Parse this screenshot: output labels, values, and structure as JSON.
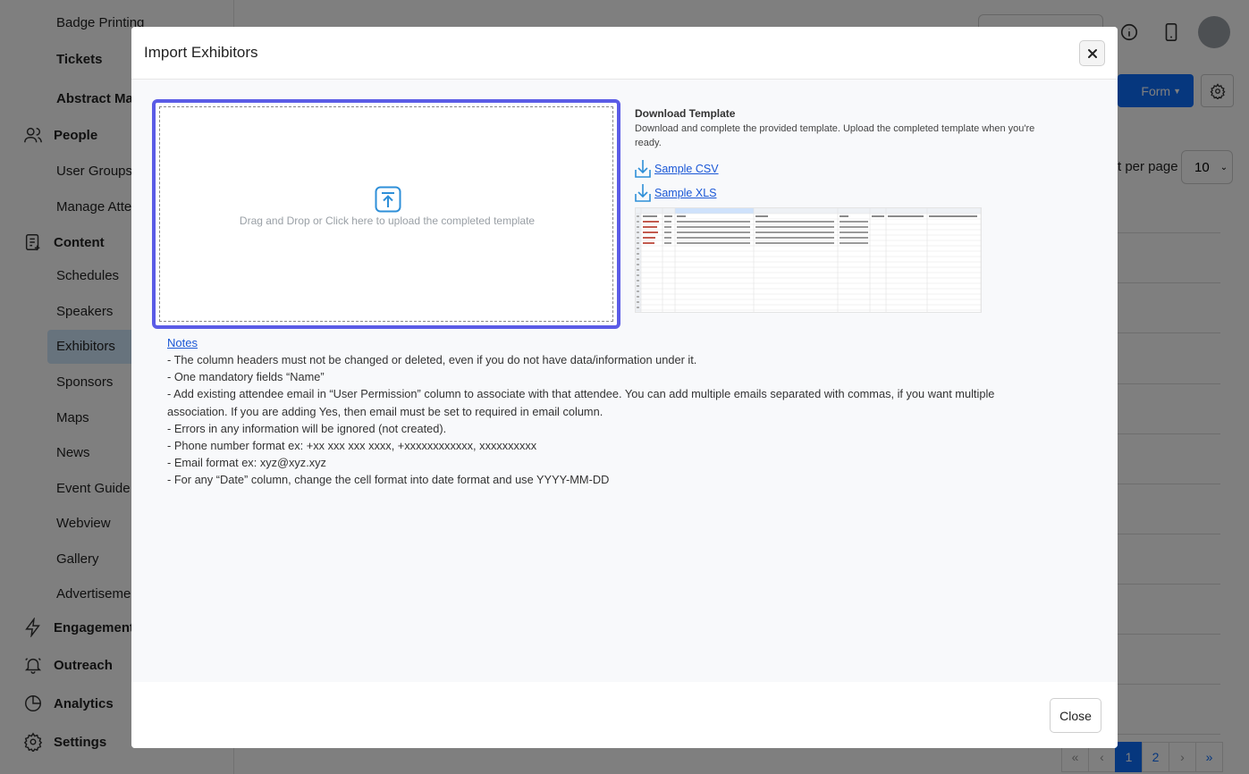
{
  "sidebar": {
    "items": [
      {
        "label": "Badge Printing"
      },
      {
        "label": "Tickets"
      },
      {
        "label": "Abstract Ma"
      },
      {
        "label": "User Groups"
      },
      {
        "label": "Manage Atte"
      },
      {
        "label": "Schedules"
      },
      {
        "label": "Speakers"
      },
      {
        "label": "Exhibitors"
      },
      {
        "label": "Sponsors"
      },
      {
        "label": "Maps"
      },
      {
        "label": "News"
      },
      {
        "label": "Event Guide"
      },
      {
        "label": "Webview"
      },
      {
        "label": "Gallery"
      },
      {
        "label": "Advertiseme"
      }
    ],
    "sections": [
      {
        "label": "People",
        "icon": "people-icon"
      },
      {
        "label": "Content",
        "icon": "content-icon"
      },
      {
        "label": "Engagement",
        "icon": "lightning-icon"
      },
      {
        "label": "Outreach",
        "icon": "bell-icon"
      },
      {
        "label": "Analytics",
        "icon": "pie-chart-icon"
      },
      {
        "label": "Settings",
        "icon": "gear-icon"
      }
    ]
  },
  "background": {
    "form_button": "Form",
    "per_page_label": "t per page",
    "per_page_value": "10",
    "pagination": [
      "«",
      "‹",
      "1",
      "2",
      "›",
      "»"
    ]
  },
  "modal": {
    "title": "Import Exhibitors",
    "dropzone_text": "Drag and Drop or Click here to upload the completed template",
    "download_title": "Download Template",
    "download_desc": "Download and complete the provided template. Upload the completed template when you're ready.",
    "sample_csv": "Sample CSV",
    "sample_xls": "Sample XLS",
    "notes_link": "Notes",
    "notes": [
      "- The column headers must not be changed or deleted, even if you do not have data/information under it.",
      "- One mandatory fields “Name”",
      "- Add existing attendee email in “User Permission” column to associate with that attendee. You can add multiple emails separated with commas, if you want multiple association. If you are adding Yes, then email must be set to required in email column.",
      "- Errors in any information will be ignored (not created).",
      "- Phone number format ex: +xx xxx xxx xxxx, +xxxxxxxxxxxx, xxxxxxxxxx",
      "- Email format ex: xyz@xyz.xyz",
      "- For any “Date” column, change the cell format into date format and use YYYY-MM-DD"
    ],
    "close_button": "Close"
  },
  "colors": {
    "accent": "#5b5ce6",
    "link": "#1a57d6",
    "primary": "#0d6efd"
  }
}
